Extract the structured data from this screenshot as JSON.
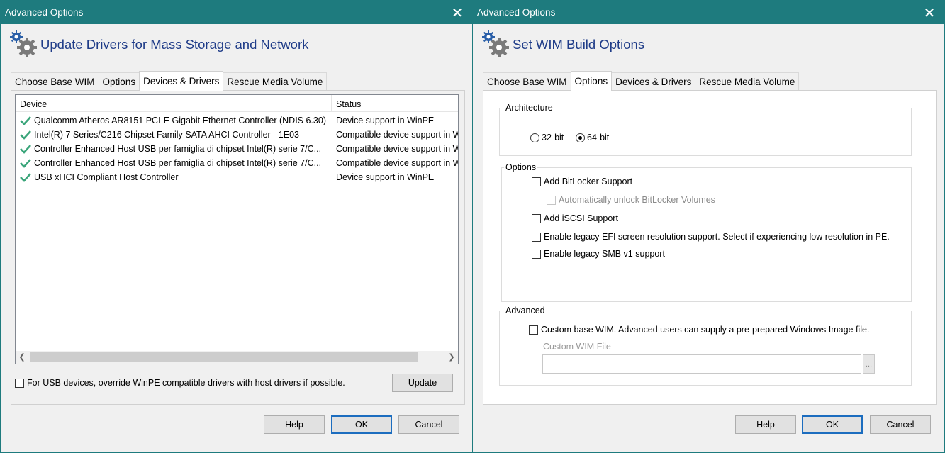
{
  "dialog1": {
    "title": "Advanced Options",
    "header": "Update Drivers for Mass Storage and Network",
    "tabs": [
      {
        "label": "Choose Base WIM",
        "active": false
      },
      {
        "label": "Options",
        "active": false
      },
      {
        "label": "Devices & Drivers",
        "active": true
      },
      {
        "label": "Rescue Media Volume",
        "active": false
      }
    ],
    "columns": {
      "device": "Device",
      "status": "Status"
    },
    "devices": [
      {
        "name": "Qualcomm Atheros AR8151 PCI-E Gigabit Ethernet Controller (NDIS 6.30)",
        "status": "Device support in WinPE"
      },
      {
        "name": "Intel(R) 7 Series/C216 Chipset Family SATA AHCI Controller - 1E03",
        "status": "Compatible device support in WinPE"
      },
      {
        "name": "Controller Enhanced Host USB per famiglia di chipset Intel(R) serie 7/C...",
        "status": "Compatible device support in WinPE"
      },
      {
        "name": "Controller Enhanced Host USB per famiglia di chipset Intel(R) serie 7/C...",
        "status": "Compatible device support in WinPE"
      },
      {
        "name": "USB xHCI Compliant Host Controller",
        "status": "Device support in WinPE"
      }
    ],
    "override_label": "For USB devices, override WinPE compatible drivers with host drivers if possible.",
    "update_label": "Update",
    "buttons": {
      "help": "Help",
      "ok": "OK",
      "cancel": "Cancel"
    }
  },
  "dialog2": {
    "title": "Advanced Options",
    "header": "Set WIM Build Options",
    "tabs": [
      {
        "label": "Choose Base WIM",
        "active": false
      },
      {
        "label": "Options",
        "active": true
      },
      {
        "label": "Devices & Drivers",
        "active": false
      },
      {
        "label": "Rescue Media Volume",
        "active": false
      }
    ],
    "architecture": {
      "legend": "Architecture",
      "opt32": "32-bit",
      "opt64": "64-bit",
      "selected": "64-bit"
    },
    "options": {
      "legend": "Options",
      "bitlocker": "Add BitLocker Support",
      "auto_unlock": "Automatically unlock BitLocker Volumes",
      "iscsi": "Add iSCSI Support",
      "efi": "Enable legacy EFI screen resolution support.  Select if experiencing low resolution in PE.",
      "smb": "Enable legacy SMB v1 support"
    },
    "advanced": {
      "legend": "Advanced",
      "custom_base": "Custom base WIM. Advanced users can supply a pre-prepared Windows Image file.",
      "custom_file_label": "Custom WIM File",
      "custom_file_value": "",
      "browse": "..."
    },
    "buttons": {
      "help": "Help",
      "ok": "OK",
      "cancel": "Cancel"
    }
  },
  "icons": {
    "close": "close-icon",
    "header": "gears-icon",
    "check": "check-icon"
  },
  "colors": {
    "titlebar": "#1e7b7e",
    "header_text": "#1f3c88",
    "check": "#3aa57a",
    "default_button": "#1c6dbf"
  }
}
